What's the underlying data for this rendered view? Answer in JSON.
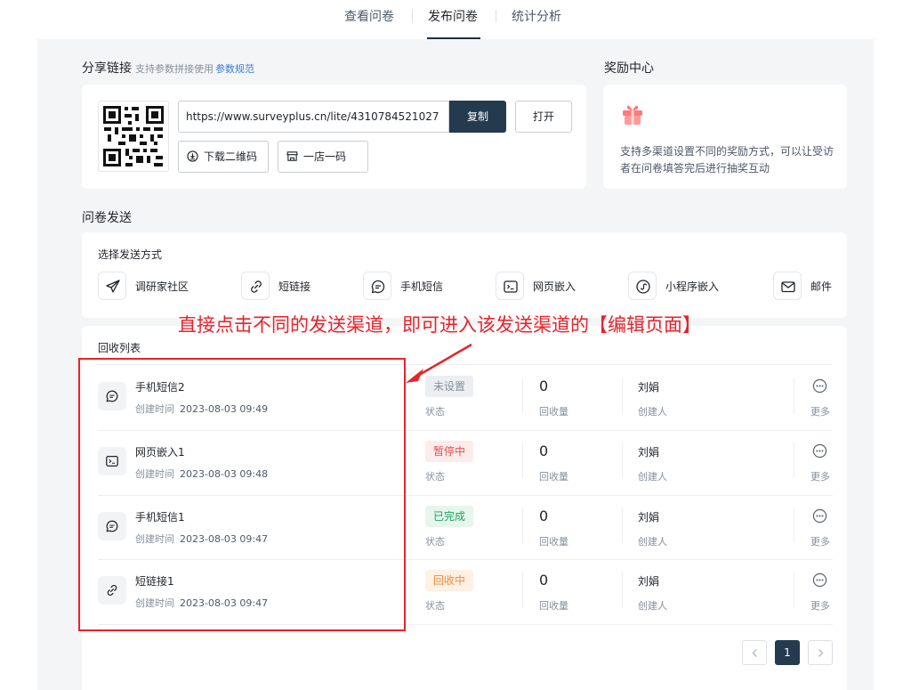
{
  "tabs": [
    {
      "label": "查看问卷"
    },
    {
      "label": "发布问卷"
    },
    {
      "label": "统计分析"
    }
  ],
  "share": {
    "title": "分享链接",
    "hint": "支持参数拼接使用",
    "hint_link": "参数规范",
    "url": "https://www.surveyplus.cn/lite/4310784521027",
    "copy_label": "复制",
    "open_label": "打开",
    "download_qr_label": "下载二维码",
    "store_code_label": "一店一码"
  },
  "reward": {
    "title": "奖励中心",
    "description": "支持多渠道设置不同的奖励方式，可以让受访者在问卷填答完后进行抽奖互动"
  },
  "send": {
    "title": "问卷发送",
    "choose_label": "选择发送方式",
    "methods": [
      {
        "label": "调研家社区",
        "icon": "paper-plane-icon"
      },
      {
        "label": "短链接",
        "icon": "link-icon"
      },
      {
        "label": "手机短信",
        "icon": "message-icon"
      },
      {
        "label": "网页嵌入",
        "icon": "terminal-icon"
      },
      {
        "label": "小程序嵌入",
        "icon": "mini-program-icon"
      },
      {
        "label": "邮件",
        "icon": "mail-icon"
      }
    ]
  },
  "annotation": {
    "text": "直接点击不同的发送渠道，即可进入该发送渠道的【编辑页面】",
    "color": "#e8232a"
  },
  "recovery": {
    "title": "回收列表",
    "created_key": "创建时间",
    "status_key": "状态",
    "count_key": "回收量",
    "creator_key": "创建人",
    "more_key": "更多",
    "rows": [
      {
        "name": "手机短信2",
        "time": "2023-08-03 09:49",
        "status": "未设置",
        "status_kind": "gray",
        "count": "0",
        "creator": "刘娟",
        "icon": "message-icon"
      },
      {
        "name": "网页嵌入1",
        "time": "2023-08-03 09:48",
        "status": "暂停中",
        "status_kind": "red",
        "count": "0",
        "creator": "刘娟",
        "icon": "terminal-icon"
      },
      {
        "name": "手机短信1",
        "time": "2023-08-03 09:47",
        "status": "已完成",
        "status_kind": "green",
        "count": "0",
        "creator": "刘娟",
        "icon": "message-icon"
      },
      {
        "name": "短链接1",
        "time": "2023-08-03 09:47",
        "status": "回收中",
        "status_kind": "orange",
        "count": "0",
        "creator": "刘娟",
        "icon": "link-icon"
      }
    ]
  },
  "pagination": {
    "current": "1"
  },
  "colors": {
    "primary": "#243a4e",
    "canvas": "#f4f5f7"
  }
}
